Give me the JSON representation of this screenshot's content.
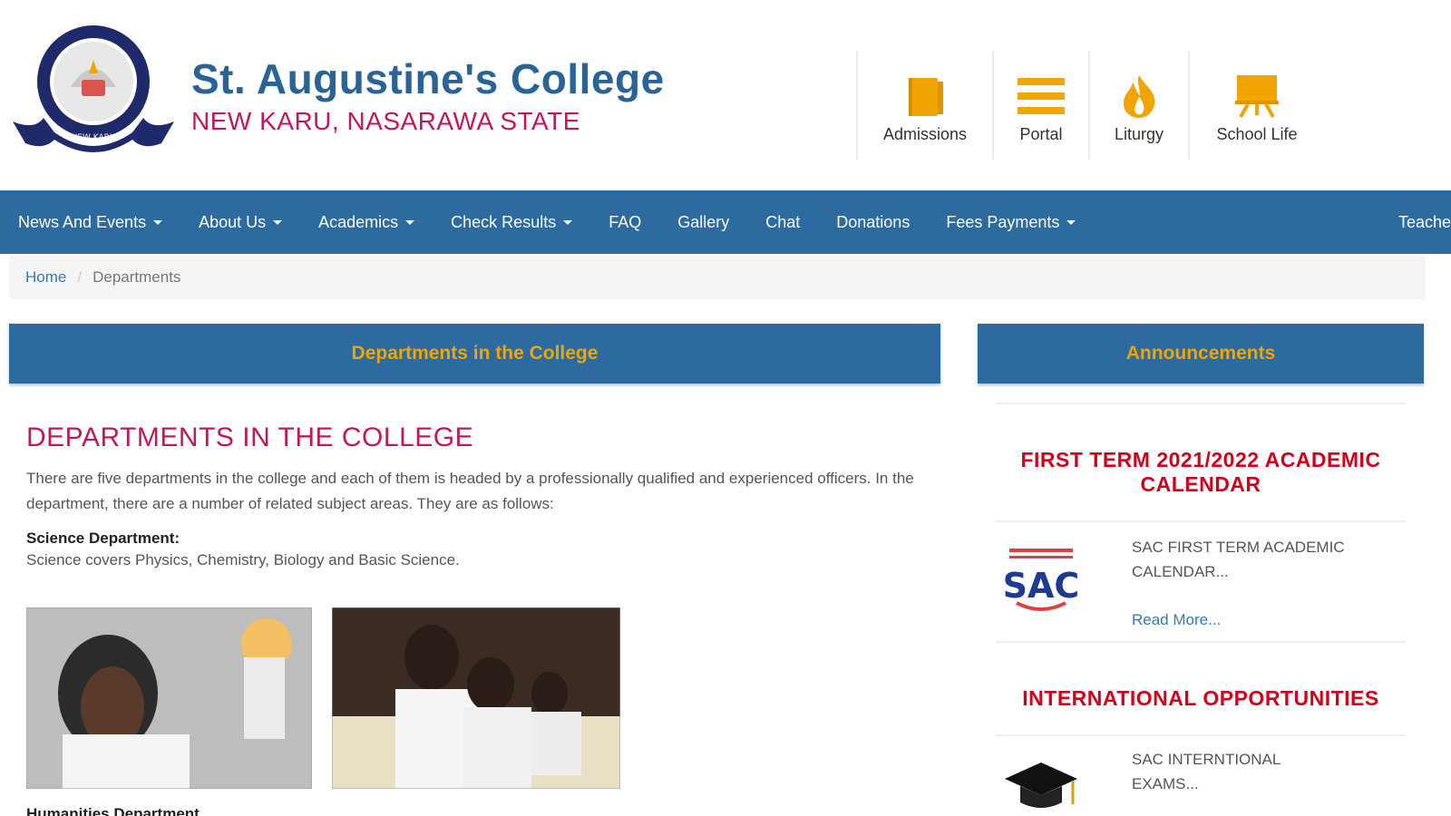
{
  "site": {
    "title": "St. Augustine's College",
    "subtitle": "NEW KARU, NASARAWA STATE"
  },
  "quick_links": [
    {
      "label": "Admissions",
      "icon": "book-icon"
    },
    {
      "label": "Portal",
      "icon": "menu-bars-icon"
    },
    {
      "label": "Liturgy",
      "icon": "flame-icon"
    },
    {
      "label": "School Life",
      "icon": "easel-icon"
    }
  ],
  "nav": [
    {
      "label": "News And Events",
      "dropdown": true
    },
    {
      "label": "About Us",
      "dropdown": true
    },
    {
      "label": "Academics",
      "dropdown": true
    },
    {
      "label": "Check Results",
      "dropdown": true
    },
    {
      "label": "FAQ",
      "dropdown": false
    },
    {
      "label": "Gallery",
      "dropdown": false
    },
    {
      "label": "Chat",
      "dropdown": false
    },
    {
      "label": "Donations",
      "dropdown": false
    },
    {
      "label": "Fees Payments",
      "dropdown": true
    },
    {
      "label": "Teache",
      "dropdown": false
    }
  ],
  "breadcrumb": {
    "home": "Home",
    "current": "Departments"
  },
  "main": {
    "panel_title": "Departments in the College",
    "heading": "DEPARTMENTS IN THE COLLEGE",
    "intro": "There are five departments in the college and each of them is headed by a professionally qualified and experienced officers. In the department, there are a number of related subject areas. They are as follows:",
    "departments": [
      {
        "title": "Science Department:",
        "desc": "Science covers Physics, Chemistry, Biology and Basic Science."
      },
      {
        "title": "Humanities Department",
        "desc": ""
      }
    ]
  },
  "sidebar": {
    "panel_title": "Announcements",
    "items": [
      {
        "heading": "FIRST TERM 2021/2022 ACADEMIC CALENDAR",
        "text": "SAC FIRST TERM ACADEMIC CALENDAR...",
        "more": "Read More...",
        "thumb_logo": "SAC"
      },
      {
        "heading": "INTERNATIONAL OPPORTUNITIES",
        "text": "SAC INTERNTIONAL EXAMS...",
        "more": "",
        "thumb_logo": ""
      }
    ]
  },
  "colors": {
    "brand_blue": "#2d6a9f",
    "title_blue": "#2a6496",
    "accent_orange": "#f0a500",
    "accent_red": "#d0021b",
    "subtitle_pink": "#c2185b"
  }
}
